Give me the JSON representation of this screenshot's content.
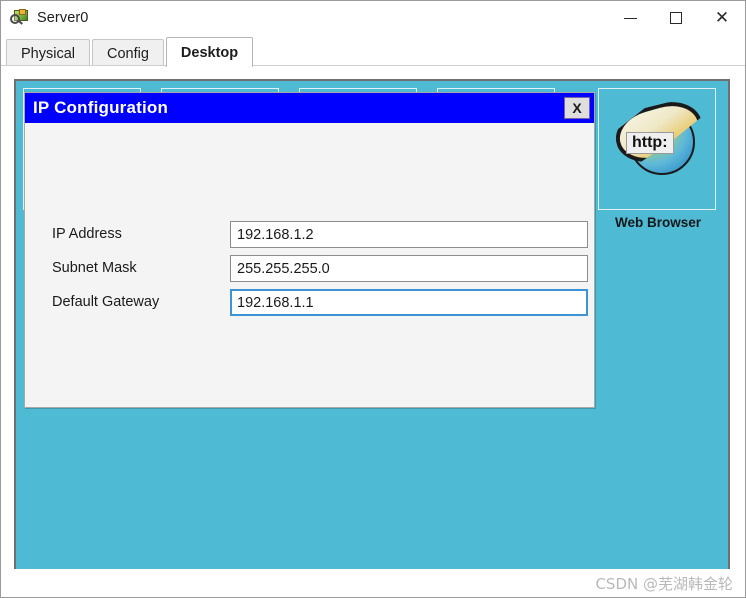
{
  "window": {
    "title": "Server0",
    "icon": "packet-tracer-device-icon",
    "controls": {
      "minimize": "–",
      "maximize": "☐",
      "close": "✕"
    }
  },
  "tabs": [
    {
      "label": "Physical",
      "active": false
    },
    {
      "label": "Config",
      "active": false
    },
    {
      "label": "Desktop",
      "active": true
    }
  ],
  "desktop": {
    "background_color": "#4fbad4",
    "tiles": [
      {
        "label": ""
      },
      {
        "label": ""
      },
      {
        "label": ""
      },
      {
        "label": ""
      },
      {
        "label": "Web Browser",
        "icon": "web-browser-globe-icon",
        "badge": "http:"
      }
    ]
  },
  "dialog": {
    "title": "IP Configuration",
    "title_bar_color": "#0000ff",
    "close_label": "X",
    "fields": [
      {
        "label": "IP Address",
        "value": "192.168.1.2",
        "placeholder": "",
        "focused": false
      },
      {
        "label": "Subnet Mask",
        "value": "255.255.255.0",
        "placeholder": "",
        "focused": false
      },
      {
        "label": "Default Gateway",
        "value": "192.168.1.1",
        "placeholder": "",
        "focused": true
      }
    ],
    "focus_border_color": "#3c93d6"
  },
  "footer": {
    "watermark": "CSDN @芜湖韩金轮"
  }
}
